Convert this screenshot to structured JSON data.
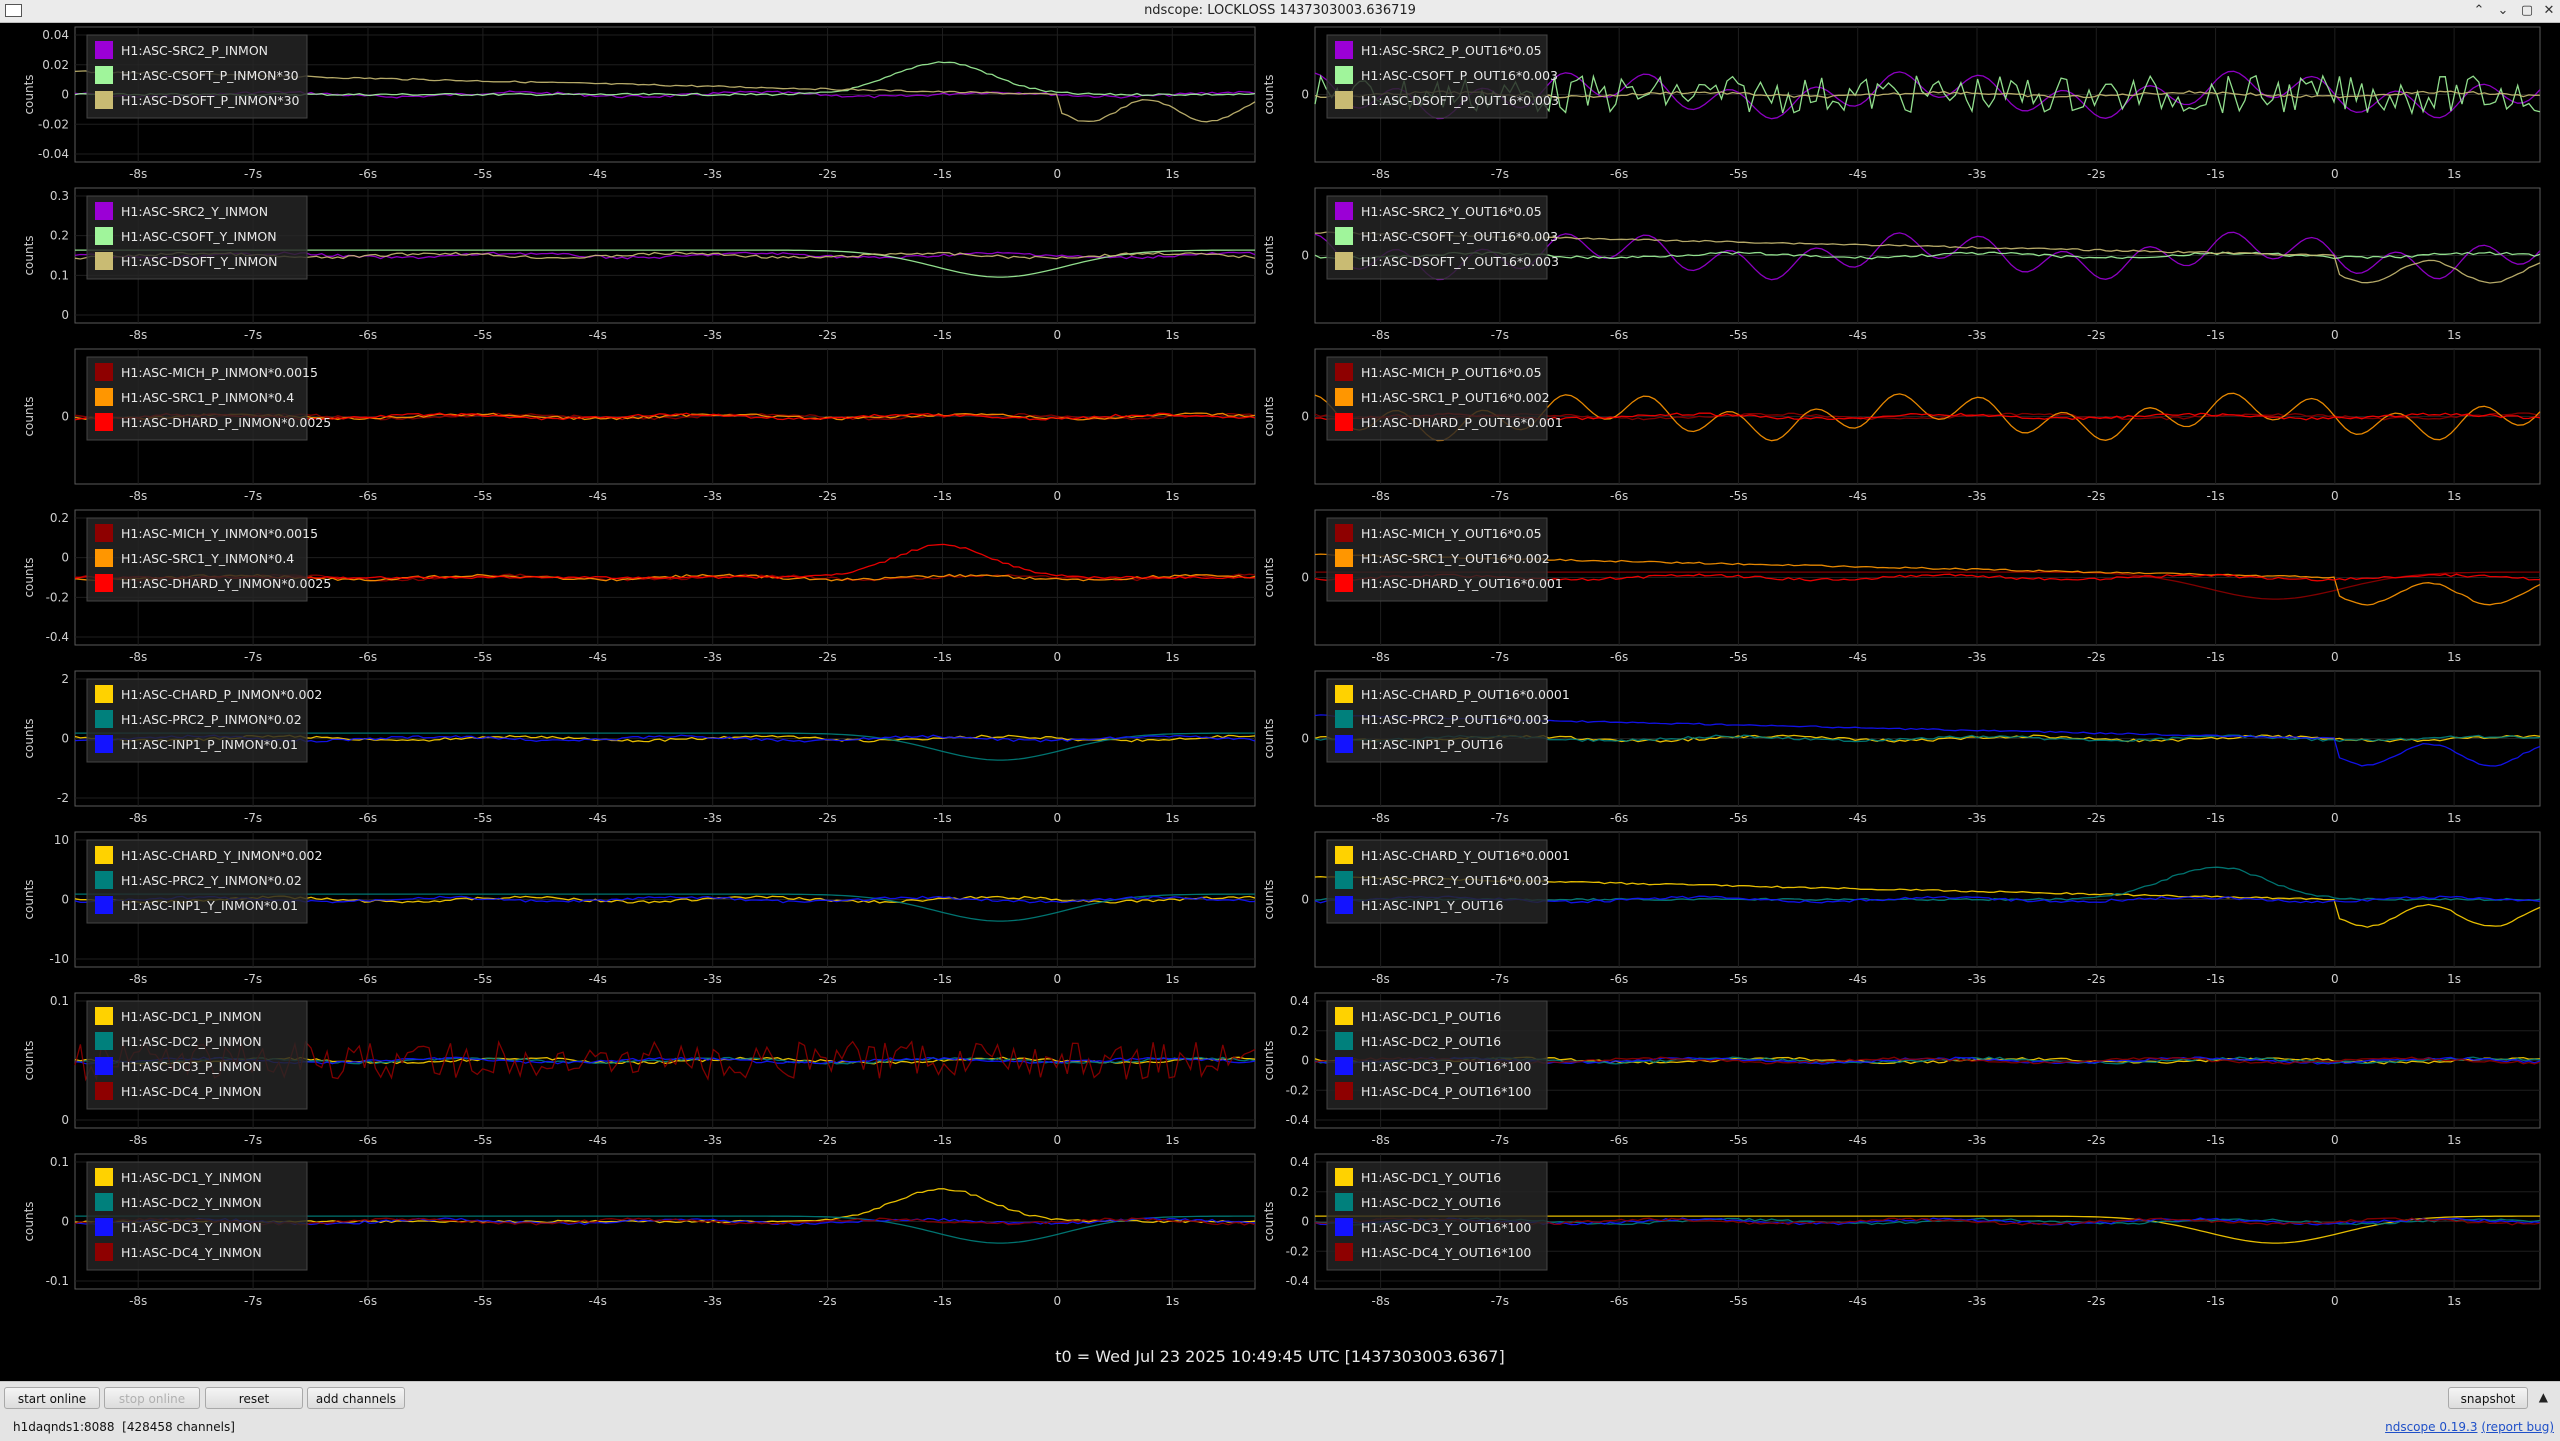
{
  "window": {
    "title": "ndscope: LOCKLOSS 1437303003.636719",
    "controls": [
      "⌃",
      "⌄",
      "▢",
      "✕"
    ]
  },
  "t0_label": "t0 = Wed Jul 23 2025 10:49:45 UTC [1437303003.6367]",
  "x_ticks": [
    "-8s",
    "-7s",
    "-6s",
    "-5s",
    "-4s",
    "-3s",
    "-2s",
    "-1s",
    "0",
    "1s"
  ],
  "y_axis_label": "counts",
  "colors": {
    "purple": "#9b00d6",
    "lightgreen": "#a0f59b",
    "khaki": "#c9bb73",
    "darkred": "#8e0000",
    "orange": "#ff9600",
    "red": "#ff0000",
    "yellow": "#ffd200",
    "teal": "#00807c",
    "blue": "#1313ff"
  },
  "plots": [
    {
      "id": "p1",
      "yticks": [
        "0.04",
        "0.02",
        "0",
        "-0.02",
        "-0.04"
      ],
      "legend": [
        {
          "label": "H1:ASC-SRC2_P_INMON",
          "color": "purple"
        },
        {
          "label": "H1:ASC-CSOFT_P_INMON*30",
          "color": "lightgreen"
        },
        {
          "label": "H1:ASC-DSOFT_P_INMON*30",
          "color": "khaki"
        }
      ]
    },
    {
      "id": "p2",
      "yticks": [
        "0"
      ],
      "legend": [
        {
          "label": "H1:ASC-SRC2_P_OUT16*0.05",
          "color": "purple"
        },
        {
          "label": "H1:ASC-CSOFT_P_OUT16*0.003",
          "color": "lightgreen"
        },
        {
          "label": "H1:ASC-DSOFT_P_OUT16*0.003",
          "color": "khaki"
        }
      ]
    },
    {
      "id": "p3",
      "yticks": [
        "0.3",
        "0.2",
        "0.1",
        "0"
      ],
      "legend": [
        {
          "label": "H1:ASC-SRC2_Y_INMON",
          "color": "purple"
        },
        {
          "label": "H1:ASC-CSOFT_Y_INMON",
          "color": "lightgreen"
        },
        {
          "label": "H1:ASC-DSOFT_Y_INMON",
          "color": "khaki"
        }
      ]
    },
    {
      "id": "p4",
      "yticks": [
        "0"
      ],
      "legend": [
        {
          "label": "H1:ASC-SRC2_Y_OUT16*0.05",
          "color": "purple"
        },
        {
          "label": "H1:ASC-CSOFT_Y_OUT16*0.003",
          "color": "lightgreen"
        },
        {
          "label": "H1:ASC-DSOFT_Y_OUT16*0.003",
          "color": "khaki"
        }
      ]
    },
    {
      "id": "p5",
      "yticks": [
        "0"
      ],
      "legend": [
        {
          "label": "H1:ASC-MICH_P_INMON*0.0015",
          "color": "darkred"
        },
        {
          "label": "H1:ASC-SRC1_P_INMON*0.4",
          "color": "orange"
        },
        {
          "label": "H1:ASC-DHARD_P_INMON*0.0025",
          "color": "red"
        }
      ]
    },
    {
      "id": "p6",
      "yticks": [
        "0"
      ],
      "legend": [
        {
          "label": "H1:ASC-MICH_P_OUT16*0.05",
          "color": "darkred"
        },
        {
          "label": "H1:ASC-SRC1_P_OUT16*0.002",
          "color": "orange"
        },
        {
          "label": "H1:ASC-DHARD_P_OUT16*0.001",
          "color": "red"
        }
      ]
    },
    {
      "id": "p7",
      "yticks": [
        "0.2",
        "0",
        "-0.2",
        "-0.4"
      ],
      "legend": [
        {
          "label": "H1:ASC-MICH_Y_INMON*0.0015",
          "color": "darkred"
        },
        {
          "label": "H1:ASC-SRC1_Y_INMON*0.4",
          "color": "orange"
        },
        {
          "label": "H1:ASC-DHARD_Y_INMON*0.0025",
          "color": "red"
        }
      ]
    },
    {
      "id": "p8",
      "yticks": [
        "0"
      ],
      "legend": [
        {
          "label": "H1:ASC-MICH_Y_OUT16*0.05",
          "color": "darkred"
        },
        {
          "label": "H1:ASC-SRC1_Y_OUT16*0.002",
          "color": "orange"
        },
        {
          "label": "H1:ASC-DHARD_Y_OUT16*0.001",
          "color": "red"
        }
      ]
    },
    {
      "id": "p9",
      "yticks": [
        "2",
        "0",
        "-2"
      ],
      "legend": [
        {
          "label": "H1:ASC-CHARD_P_INMON*0.002",
          "color": "yellow"
        },
        {
          "label": "H1:ASC-PRC2_P_INMON*0.02",
          "color": "teal"
        },
        {
          "label": "H1:ASC-INP1_P_INMON*0.01",
          "color": "blue"
        }
      ]
    },
    {
      "id": "p10",
      "yticks": [
        "0"
      ],
      "legend": [
        {
          "label": "H1:ASC-CHARD_P_OUT16*0.0001",
          "color": "yellow"
        },
        {
          "label": "H1:ASC-PRC2_P_OUT16*0.003",
          "color": "teal"
        },
        {
          "label": "H1:ASC-INP1_P_OUT16",
          "color": "blue"
        }
      ]
    },
    {
      "id": "p11",
      "yticks": [
        "10",
        "0",
        "-10"
      ],
      "legend": [
        {
          "label": "H1:ASC-CHARD_Y_INMON*0.002",
          "color": "yellow"
        },
        {
          "label": "H1:ASC-PRC2_Y_INMON*0.02",
          "color": "teal"
        },
        {
          "label": "H1:ASC-INP1_Y_INMON*0.01",
          "color": "blue"
        }
      ]
    },
    {
      "id": "p12",
      "yticks": [
        "0"
      ],
      "legend": [
        {
          "label": "H1:ASC-CHARD_Y_OUT16*0.0001",
          "color": "yellow"
        },
        {
          "label": "H1:ASC-PRC2_Y_OUT16*0.003",
          "color": "teal"
        },
        {
          "label": "H1:ASC-INP1_Y_OUT16",
          "color": "blue"
        }
      ]
    },
    {
      "id": "p13",
      "yticks": [
        "0.1",
        "0"
      ],
      "legend": [
        {
          "label": "H1:ASC-DC1_P_INMON",
          "color": "yellow"
        },
        {
          "label": "H1:ASC-DC2_P_INMON",
          "color": "teal"
        },
        {
          "label": "H1:ASC-DC3_P_INMON",
          "color": "blue"
        },
        {
          "label": "H1:ASC-DC4_P_INMON",
          "color": "darkred"
        }
      ]
    },
    {
      "id": "p14",
      "yticks": [
        "0.4",
        "0.2",
        "0",
        "-0.2",
        "-0.4"
      ],
      "legend": [
        {
          "label": "H1:ASC-DC1_P_OUT16",
          "color": "yellow"
        },
        {
          "label": "H1:ASC-DC2_P_OUT16",
          "color": "teal"
        },
        {
          "label": "H1:ASC-DC3_P_OUT16*100",
          "color": "blue"
        },
        {
          "label": "H1:ASC-DC4_P_OUT16*100",
          "color": "darkred"
        }
      ]
    },
    {
      "id": "p15",
      "yticks": [
        "0.1",
        "0",
        "-0.1"
      ],
      "legend": [
        {
          "label": "H1:ASC-DC1_Y_INMON",
          "color": "yellow"
        },
        {
          "label": "H1:ASC-DC2_Y_INMON",
          "color": "teal"
        },
        {
          "label": "H1:ASC-DC3_Y_INMON",
          "color": "blue"
        },
        {
          "label": "H1:ASC-DC4_Y_INMON",
          "color": "darkred"
        }
      ]
    },
    {
      "id": "p16",
      "yticks": [
        "0.4",
        "0.2",
        "0",
        "-0.2",
        "-0.4"
      ],
      "legend": [
        {
          "label": "H1:ASC-DC1_Y_OUT16",
          "color": "yellow"
        },
        {
          "label": "H1:ASC-DC2_Y_OUT16",
          "color": "teal"
        },
        {
          "label": "H1:ASC-DC3_Y_OUT16*100",
          "color": "blue"
        },
        {
          "label": "H1:ASC-DC4_Y_OUT16*100",
          "color": "darkred"
        }
      ]
    }
  ],
  "buttons": {
    "start_online": "start online",
    "stop_online": "stop online",
    "reset": "reset",
    "add_channels": "add channels",
    "snapshot": "snapshot"
  },
  "status": {
    "server": "h1daqnds1:8088",
    "channels": "[428458 channels]",
    "version": "ndscope 0.19.3",
    "report_bug": "(report bug)"
  }
}
